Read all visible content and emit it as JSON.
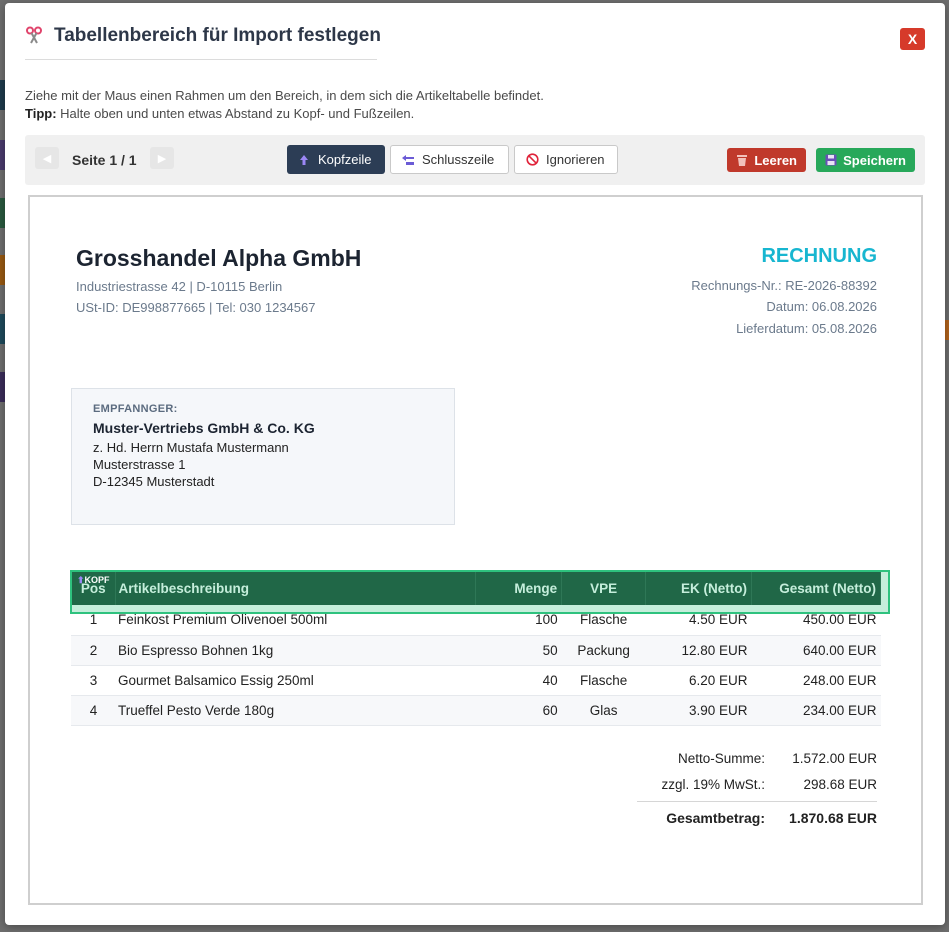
{
  "modal": {
    "title": "Tabellenbereich für Import festlegen",
    "close_label": "X",
    "hint_line1": "Ziehe mit der Maus einen Rahmen um den Bereich, in dem sich die Artikeltabelle befindet.",
    "hint_tip_label": "Tipp:",
    "hint_tip_text": " Halte oben und unten etwas Abstand zu Kopf- und Fußzeilen."
  },
  "toolbar": {
    "page_label": "Seite 1 / 1",
    "kopfzeile": "Kopfzeile",
    "schlusszeile": "Schlusszeile",
    "ignorieren": "Ignorieren",
    "leeren": "Leeren",
    "speichern": "Speichern"
  },
  "invoice": {
    "company": "Grosshandel Alpha GmbH",
    "address_line1": "Industriestrasse 42 | D-10115 Berlin",
    "address_line2": "USt-ID: DE998877665 | Tel: 030 1234567",
    "doc_type": "RECHNUNG",
    "number": "Rechnungs-Nr.: RE-2026-88392",
    "date": "Datum: 06.08.2026",
    "delivery_date": "Lieferdatum: 05.08.2026",
    "recipient": {
      "label": "EMPFANNGER:",
      "name": "Muster-Vertriebs GmbH & Co. KG",
      "line1": "z. Hd. Herrn Mustafa Mustermann",
      "line2": "Musterstrasse 1",
      "line3": "D-12345 Musterstadt"
    },
    "table": {
      "headers": [
        "Pos",
        "Artikelbeschreibung",
        "Menge",
        "VPE",
        "EK (Netto)",
        "Gesamt (Netto)"
      ],
      "rows": [
        [
          "1",
          "Feinkost Premium Olivenoel 500ml",
          "100",
          "Flasche",
          "4.50 EUR",
          "450.00 EUR"
        ],
        [
          "2",
          "Bio Espresso Bohnen 1kg",
          "50",
          "Packung",
          "12.80 EUR",
          "640.00 EUR"
        ],
        [
          "3",
          "Gourmet Balsamico Essig 250ml",
          "40",
          "Flasche",
          "6.20 EUR",
          "248.00 EUR"
        ],
        [
          "4",
          "Trueffel Pesto Verde 180g",
          "60",
          "Glas",
          "3.90 EUR",
          "234.00 EUR"
        ]
      ]
    },
    "selection_tag": "KOPF",
    "totals": {
      "net_label": "Netto-Summe:",
      "net_value": "1.572.00 EUR",
      "vat_label": "zzgl. 19% MwSt.:",
      "vat_value": "298.68 EUR",
      "total_label": "Gesamtbetrag:",
      "total_value": "1.870.68 EUR"
    }
  },
  "colors": {
    "kopf_button": "#2c3d55",
    "leeren_button": "#c0392b",
    "speichern_button": "#27a85a",
    "table_header": "#1b4433",
    "selection": "#2ec27e",
    "rechnung": "#17b6d0"
  }
}
